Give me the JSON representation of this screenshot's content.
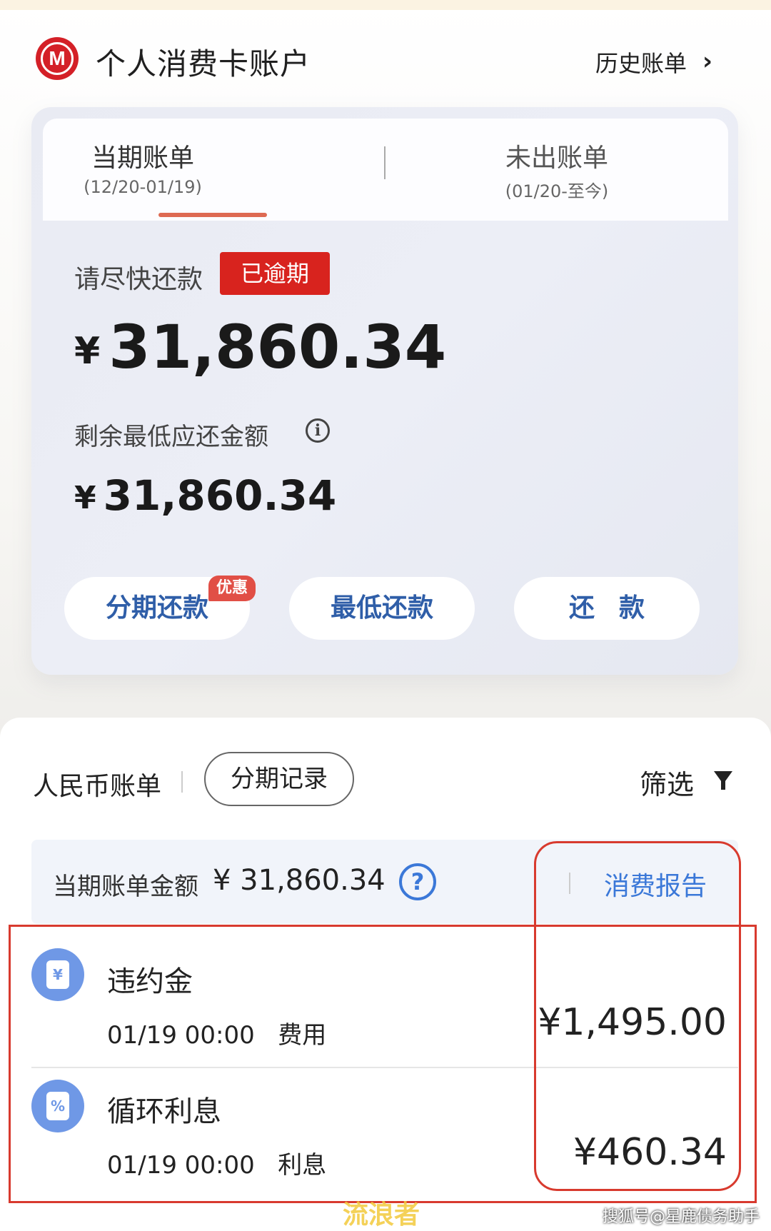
{
  "header": {
    "logo_letter": "M",
    "title": "个人消费卡账户",
    "history_label": "历史账单",
    "history_chevron": "›"
  },
  "tabs": [
    {
      "label": "当期账单",
      "date": "(12/20-01/19)"
    },
    {
      "label": "未出账单",
      "date": "(01/20-至今)"
    }
  ],
  "bill": {
    "remind_label": "请尽快还款",
    "status_badge": "已逾期",
    "currency": "¥",
    "total_amount": "31,860.34",
    "min_label": "剩余最低应还金额",
    "info_symbol": "i",
    "min_amount": "31,860.34"
  },
  "actions": {
    "installment_label": "分期还款",
    "promo_badge": "优惠",
    "min_pay_label": "最低还款",
    "repay_label": "还款"
  },
  "list_header": {
    "rmb_label": "人民币账单",
    "installment_record": "分期记录",
    "filter_label": "筛选"
  },
  "summary": {
    "label": "当期账单金额",
    "amount": "¥ 31,860.34",
    "help_symbol": "?",
    "report_label": "消费报告"
  },
  "transactions": [
    {
      "icon": "yuan-icon",
      "icon_symbol": "¥",
      "name": "违约金",
      "time": "01/19 00:00",
      "category": "费用",
      "amount": "¥1,495.00"
    },
    {
      "icon": "percent-icon",
      "icon_symbol": "%",
      "name": "循环利息",
      "time": "01/19 00:00",
      "category": "利息",
      "amount": "¥460.34"
    }
  ],
  "watermarks": {
    "main": "流浪者",
    "source": "搜狐号@星鹿债务助手"
  },
  "colors": {
    "brand_red": "#d42027",
    "overdue_red": "#d8231e",
    "link_blue": "#3b78d8",
    "button_blue": "#2f5ea8",
    "tab_underline": "#de6a52",
    "highlight_box": "#d83a2e"
  }
}
